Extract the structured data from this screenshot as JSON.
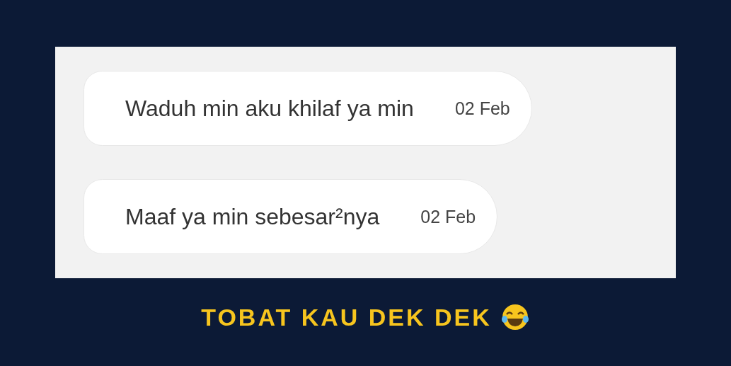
{
  "messages": [
    {
      "text": "Waduh min aku khilaf ya min",
      "date": "02 Feb"
    },
    {
      "text": "Maaf ya min sebesar²nya",
      "date": "02 Feb"
    }
  ],
  "caption": {
    "text": "TOBAT KAU DEK DEK"
  }
}
